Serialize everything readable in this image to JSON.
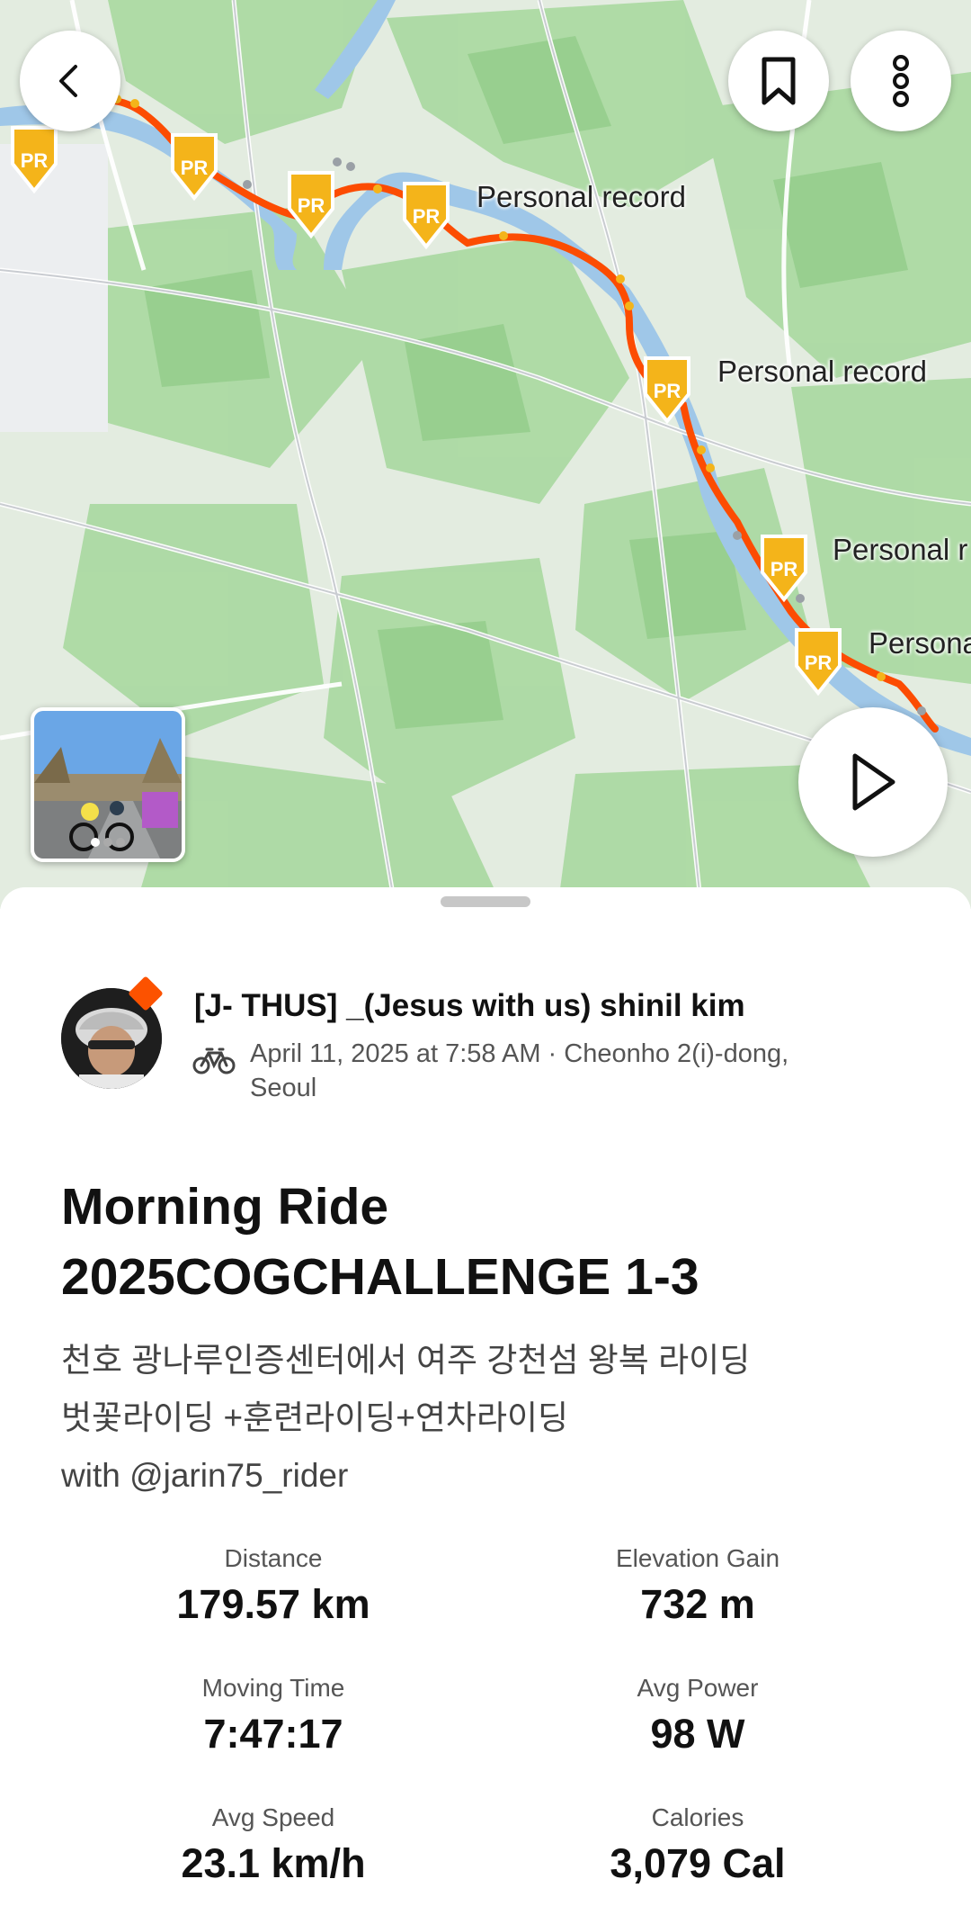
{
  "map": {
    "pr_badge_text": "PR",
    "pr_labels": [
      "Personal record",
      "Personal record",
      "Personal r",
      "Persona"
    ],
    "route_color": "#fc4c02",
    "pr_color": "#f4b41a"
  },
  "nav": {
    "back_icon": "chevron-left-icon",
    "bookmark_icon": "bookmark-icon",
    "more_icon": "more-vertical-icon",
    "play_icon": "play-icon"
  },
  "activity": {
    "athlete_name": "[J- THUS] _(Jesus with us) shinil kim",
    "date_location_line1": "April 11, 2025 at 7:58 AM · Cheonho 2(i)-dong,",
    "date_location_line2": "Seoul",
    "title_line1": "Morning Ride",
    "title_line2": "2025COGCHALLENGE 1-3",
    "description_line1": "천호 광나루인증센터에서 여주 강천섬 왕복 라이딩",
    "description_line2": "벗꽃라이딩 +훈련라이딩+연차라이딩",
    "description_line3": "with @jarin75_rider"
  },
  "stats": [
    {
      "label": "Distance",
      "value": "179.57 km"
    },
    {
      "label": "Elevation Gain",
      "value": "732 m"
    },
    {
      "label": "Moving Time",
      "value": "7:47:17"
    },
    {
      "label": "Avg Power",
      "value": "98 W"
    },
    {
      "label": "Avg Speed",
      "value": "23.1 km/h"
    },
    {
      "label": "Calories",
      "value": "3,079 Cal"
    }
  ]
}
